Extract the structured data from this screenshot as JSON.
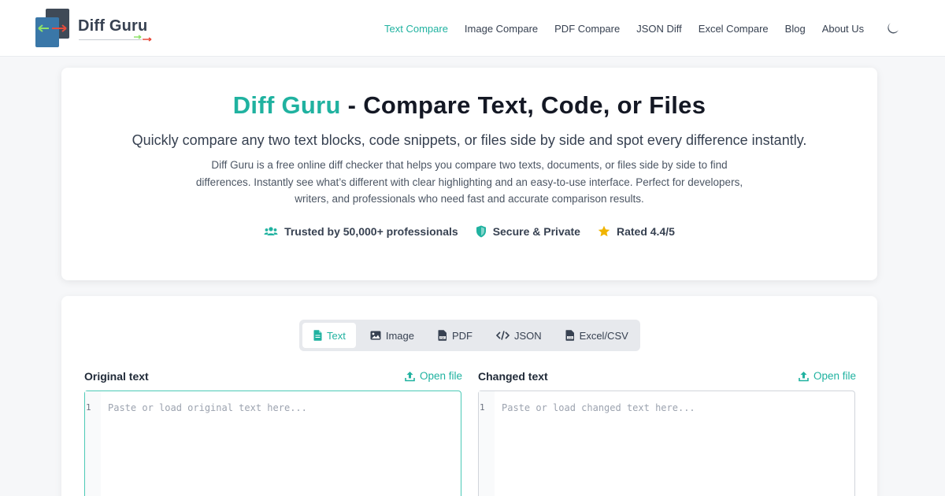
{
  "brand": {
    "name": "Diff Guru",
    "accent": "#20b2a0"
  },
  "nav": {
    "items": [
      {
        "label": "Text Compare",
        "active": true
      },
      {
        "label": "Image Compare",
        "active": false
      },
      {
        "label": "PDF Compare",
        "active": false
      },
      {
        "label": "JSON Diff",
        "active": false
      },
      {
        "label": "Excel Compare",
        "active": false
      },
      {
        "label": "Blog",
        "active": false
      },
      {
        "label": "About Us",
        "active": false
      }
    ],
    "theme_toggle_icon": "moon-icon"
  },
  "hero": {
    "title_brand": "Diff Guru",
    "title_rest": " - Compare Text, Code, or Files",
    "subtitle": "Quickly compare any two text blocks, code snippets, or files side by side and spot every difference instantly.",
    "description": "Diff Guru is a free online diff checker that helps you compare two texts, documents, or files side by side to find differences. Instantly see what’s different with clear highlighting and an easy-to-use interface. Perfect for developers, writers, and professionals who need fast and accurate comparison results.",
    "badges": [
      {
        "icon": "users-icon",
        "label": "Trusted by 50,000+ professionals"
      },
      {
        "icon": "shield-icon",
        "label": "Secure & Private"
      },
      {
        "icon": "star-icon",
        "label": "Rated 4.4/5"
      }
    ]
  },
  "compare": {
    "tabs": [
      {
        "icon": "document-icon",
        "label": "Text",
        "active": true
      },
      {
        "icon": "image-icon",
        "label": "Image",
        "active": false
      },
      {
        "icon": "pdf-icon",
        "label": "PDF",
        "active": false
      },
      {
        "icon": "code-icon",
        "label": "JSON",
        "active": false
      },
      {
        "icon": "csv-icon",
        "label": "Excel/CSV",
        "active": false
      }
    ],
    "original": {
      "label": "Original text",
      "open_file": "Open file",
      "line_number": "1",
      "placeholder": "Paste or load original text here..."
    },
    "changed": {
      "label": "Changed text",
      "open_file": "Open file",
      "line_number": "1",
      "placeholder": "Paste or load changed text here..."
    }
  }
}
